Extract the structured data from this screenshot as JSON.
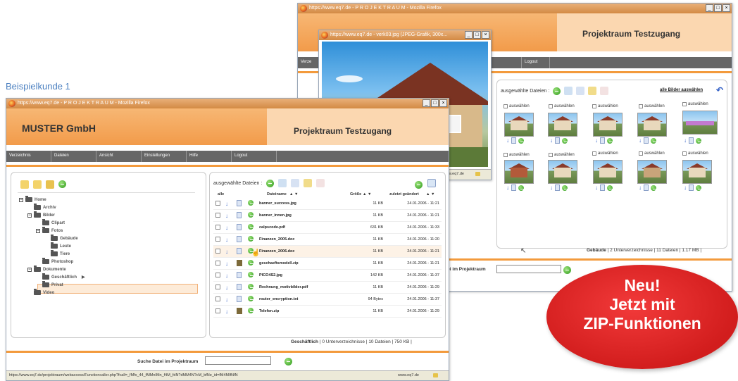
{
  "caption": "Beispielkunde 1",
  "back_window": {
    "title": "https://www.eq7.de - P R O J E K T R A U M - Mozilla Firefox",
    "header_right": "Projektraum Testzugang",
    "nav": [
      "Verze",
      "",
      "Logout"
    ],
    "toolbar_label": "ausgewählte Dateien :",
    "select_all_link": "alle Bilder auswählen",
    "select_label": "auswählen",
    "status": "Gebäude",
    "status_info": "| 2 Unterverzeichnisse | 11 Dateien | 1.17 MB |",
    "search_label": "tei im Projektraum"
  },
  "popup_window": {
    "title": "https://www.eq7.de - verk03.jpg (JPEG-Grafik, 300x...",
    "status_url": "ww.eq7.de"
  },
  "front_window": {
    "title": "https://www.eq7.de - P R O J E K T R A U M - Mozilla Firefox",
    "company": "MUSTER GmbH",
    "header_right": "Projektraum Testzugang",
    "nav": [
      "Verzeichnis",
      "Dateien",
      "Ansicht",
      "Einstellungen",
      "Hilfe",
      "Logout"
    ],
    "toolbar_label": "ausgewählte Dateien :",
    "tree": [
      {
        "label": "Home",
        "level": 0,
        "toggle": "−"
      },
      {
        "label": "Archiv",
        "level": 1,
        "toggle": ""
      },
      {
        "label": "Bilder",
        "level": 1,
        "toggle": "−"
      },
      {
        "label": "Clipart",
        "level": 2,
        "toggle": ""
      },
      {
        "label": "Fotos",
        "level": 2,
        "toggle": "−"
      },
      {
        "label": "Gebäude",
        "level": 3,
        "toggle": ""
      },
      {
        "label": "Leute",
        "level": 3,
        "toggle": ""
      },
      {
        "label": "Tiere",
        "level": 3,
        "toggle": ""
      },
      {
        "label": "Photoshop",
        "level": 2,
        "toggle": ""
      },
      {
        "label": "Dokumente",
        "level": 1,
        "toggle": "−"
      },
      {
        "label": "Geschäftlich",
        "level": 2,
        "toggle": ""
      },
      {
        "label": "Privat",
        "level": 2,
        "toggle": ""
      },
      {
        "label": "Video",
        "level": 1,
        "toggle": ""
      }
    ],
    "columns": {
      "all": "alle",
      "name": "Dateiname",
      "size": "Größe",
      "changed": "zuletzt geändert"
    },
    "files": [
      {
        "name": "banner_success.jpg",
        "size": "11 KB",
        "date": "24.01.2006 - 11:21",
        "type": "file"
      },
      {
        "name": "banner_innen.jpg",
        "size": "11 KB",
        "date": "24.01.2006 - 11:21",
        "type": "file"
      },
      {
        "name": "calpscode.pdf",
        "size": "631 KB",
        "date": "24.01.2006 - 11:33",
        "type": "file"
      },
      {
        "name": "Finanzen_2005.doc",
        "size": "11 KB",
        "date": "24.01.2006 - 11:20",
        "type": "file"
      },
      {
        "name": "Finanzen_2006.doc",
        "size": "11 KB",
        "date": "24.01.2006 - 11:21",
        "type": "file"
      },
      {
        "name": "geschaeftsmodell.zip",
        "size": "11 KB",
        "date": "24.01.2006 - 11:21",
        "type": "zip"
      },
      {
        "name": "PICO4S2.jpg",
        "size": "142 KB",
        "date": "24.01.2006 - 11:37",
        "type": "file"
      },
      {
        "name": "Rechnung_motivbilder.pdf",
        "size": "11 KB",
        "date": "24.01.2006 - 11:29",
        "type": "file"
      },
      {
        "name": "router_encryption.txt",
        "size": "94 Bytes",
        "date": "24.01.2006 - 11:37",
        "type": "file"
      },
      {
        "name": "Telefon.zip",
        "size": "11 KB",
        "date": "24.01.2006 - 11:29",
        "type": "zip"
      }
    ],
    "status": "Geschäftlich",
    "status_info": "| 0 Unterverzeichnisse | 10 Dateien | 750 KB |",
    "search_label": "Suche Datei im Projektraum",
    "statusbar_url": "https://www.eq7.de/projektraum/webaccess/Functioncaller.php?fcall=_fMfx_44_fMMnIMn_f4M_fdN?dMM4N?cM_bfNe_id=fM4MIfNfN",
    "statusbar_host": "www.eq7.de"
  },
  "badge": {
    "line1": "Neu!",
    "line2": "Jetzt mit",
    "line3": "ZIP-Funktionen"
  }
}
